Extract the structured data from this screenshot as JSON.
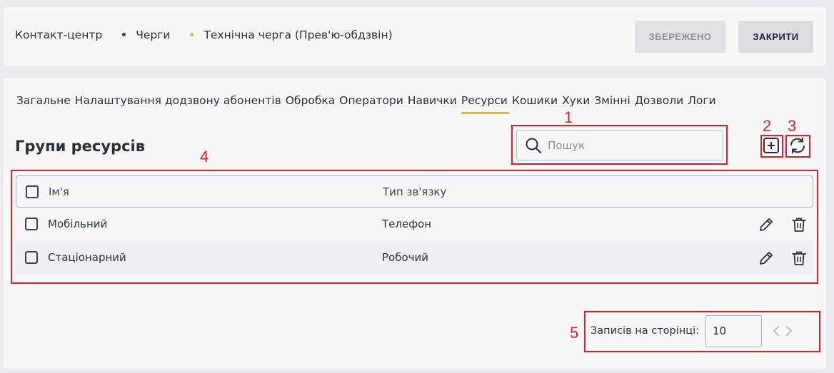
{
  "breadcrumb": {
    "items": [
      "Контакт-центр",
      "Черги",
      "Технічна черга (Прев'ю-обдзвін)"
    ]
  },
  "header": {
    "saved_label": "ЗБЕРЕЖЕНО",
    "close_label": "ЗАКРИТИ"
  },
  "tabs": [
    {
      "label": "Загальне",
      "active": false
    },
    {
      "label": "Налаштування додзвону абонентів",
      "active": false
    },
    {
      "label": "Обробка",
      "active": false
    },
    {
      "label": "Оператори",
      "active": false
    },
    {
      "label": "Навички",
      "active": false
    },
    {
      "label": "Ресурси",
      "active": true
    },
    {
      "label": "Кошики",
      "active": false
    },
    {
      "label": "Хуки",
      "active": false
    },
    {
      "label": "Змінні",
      "active": false
    },
    {
      "label": "Дозволи",
      "active": false
    },
    {
      "label": "Логи",
      "active": false
    }
  ],
  "section": {
    "title": "Групи ресурсів"
  },
  "search": {
    "placeholder": "Пошук",
    "value": ""
  },
  "icons": {
    "search": "search-icon",
    "add": "add-square-icon",
    "refresh": "refresh-icon",
    "edit": "pencil-icon",
    "delete": "trash-icon",
    "prev": "chevron-left-icon",
    "next": "chevron-right-icon"
  },
  "table": {
    "columns": [
      "Ім'я",
      "Тип зв'язку"
    ],
    "rows": [
      {
        "name": "Мобільний",
        "type": "Телефон"
      },
      {
        "name": "Стаціонарний",
        "type": "Робочий"
      }
    ]
  },
  "pagination": {
    "label": "Записів на сторінці:",
    "page_size": "10"
  },
  "annotations": {
    "labels": [
      "1",
      "2",
      "3",
      "4",
      "5"
    ],
    "color": "#e02020"
  },
  "colors": {
    "accent": "#f0b323",
    "text": "#2b2f3a",
    "annotation": "#e02020"
  }
}
